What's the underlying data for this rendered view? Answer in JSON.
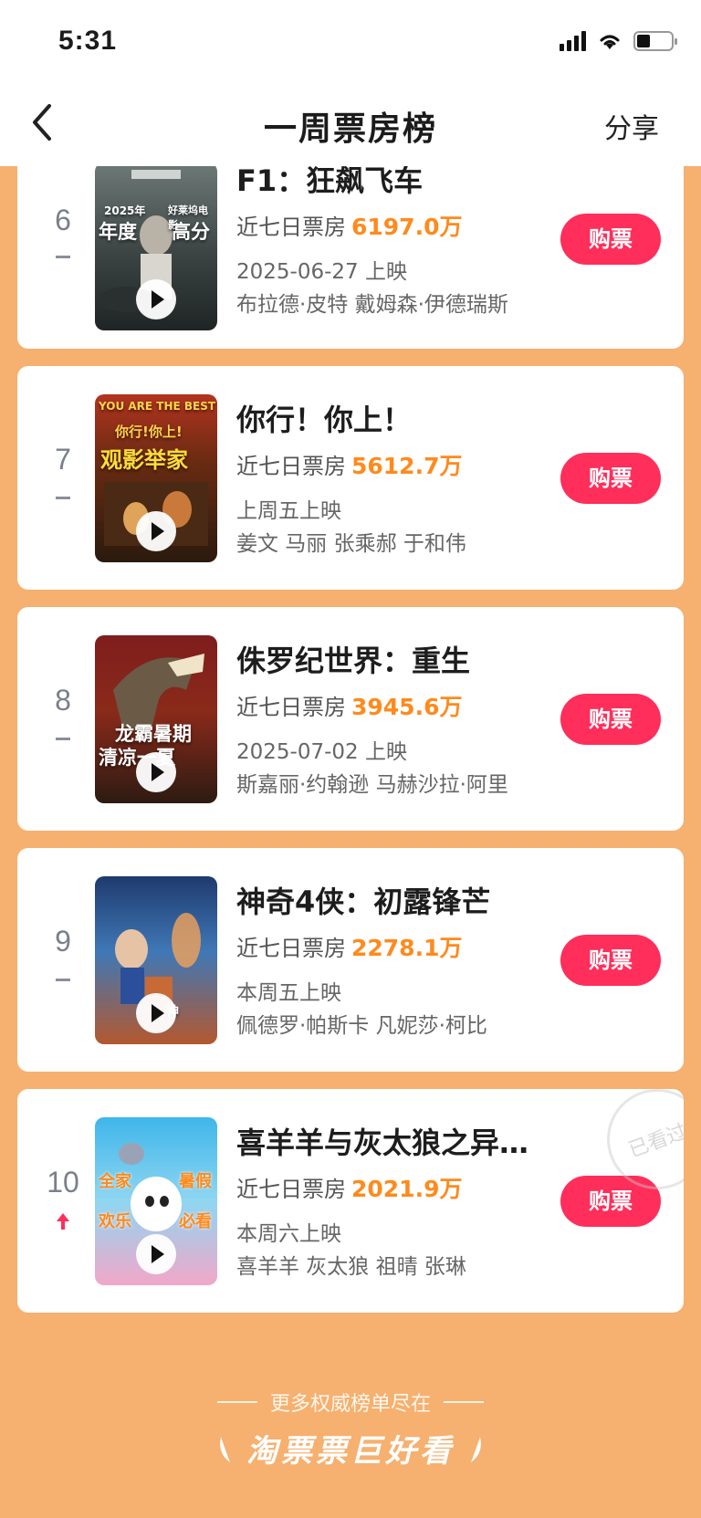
{
  "status": {
    "time": "5:31"
  },
  "nav": {
    "back_icon": "chevron-left-icon",
    "title": "一周票房榜",
    "share": "分享"
  },
  "colors": {
    "background": "#f6b06f",
    "accent": "#ff2e5a",
    "box_office": "#ff8a1c"
  },
  "list": [
    {
      "rank": "6",
      "trend": "flat",
      "title": "F1：狂飙飞车",
      "bo_label": "近七日票房",
      "bo_value": "6197.0万",
      "release": "2025-06-27 上映",
      "cast": "布拉德·皮特 戴姆森·伊德瑞斯",
      "buy": "购票",
      "poster": {
        "line1": "2025年",
        "line2": "年度",
        "line3": "高分",
        "line4": "好莱坞电影"
      }
    },
    {
      "rank": "7",
      "trend": "flat",
      "title": "你行！你上！",
      "bo_label": "近七日票房",
      "bo_value": "5612.7万",
      "release": "上周五上映",
      "cast": "姜文 马丽 张乘郝 于和伟",
      "buy": "购票",
      "poster": {
        "line1": "YOU ARE THE BEST",
        "line2": "你行!你上!",
        "line3": "观影举家"
      }
    },
    {
      "rank": "8",
      "trend": "flat",
      "title": "侏罗纪世界：重生",
      "bo_label": "近七日票房",
      "bo_value": "3945.6万",
      "release": "2025-07-02 上映",
      "cast": "斯嘉丽·约翰逊 马赫沙拉·阿里",
      "buy": "购票",
      "poster": {
        "line1": "龙霸暑期",
        "line2": "清凉一夏"
      }
    },
    {
      "rank": "9",
      "trend": "flat",
      "title": "神奇4侠：初露锋芒",
      "bo_label": "近七日票房",
      "bo_value": "2278.1万",
      "release": "本周五上映",
      "cast": "佩德罗·帕斯卡 凡妮莎·柯比",
      "buy": "购票",
      "poster": {
        "line1": "神"
      }
    },
    {
      "rank": "10",
      "trend": "up",
      "title": "喜羊羊与灰太狼之异…",
      "bo_label": "近七日票房",
      "bo_value": "2021.9万",
      "release": "本周六上映",
      "cast": "喜羊羊 灰太狼 祖晴 张琳",
      "buy": "购票",
      "stamp": "已看过",
      "poster": {
        "line1": "全家",
        "line2": "欢乐",
        "line3": "暑假",
        "line4": "必看"
      }
    }
  ],
  "footer": {
    "tagline": "更多权威榜单尽在",
    "brand": "淘票票巨好看"
  }
}
